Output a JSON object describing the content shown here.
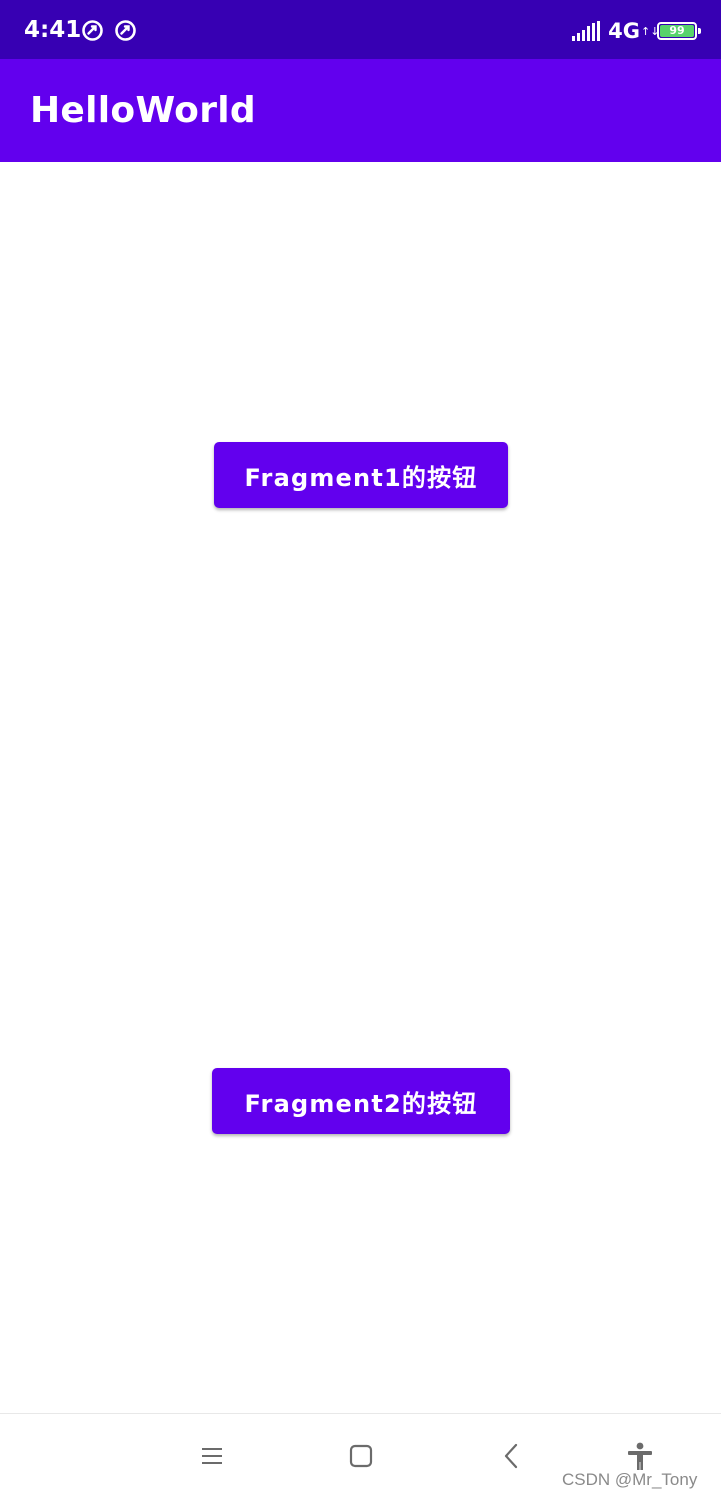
{
  "status_bar": {
    "time": "4:41",
    "network": "4G",
    "data_arrows": "↑↓",
    "battery_level": "99",
    "icons": [
      "sync-icon",
      "sync-icon",
      "signal-icon",
      "battery-icon"
    ]
  },
  "app_bar": {
    "title": "HelloWorld"
  },
  "fragments": {
    "button1_label": "Fragment1的按钮",
    "button2_label": "Fragment2的按钮"
  },
  "nav_bar": {
    "icons": [
      "menu-icon",
      "home-icon",
      "back-icon",
      "accessibility-icon"
    ]
  },
  "watermark": "CSDN @Mr_Tony",
  "colors": {
    "status_bar": "#3700b3",
    "primary": "#6200ee",
    "background": "#ffffff",
    "battery_fill": "#58d36c"
  }
}
